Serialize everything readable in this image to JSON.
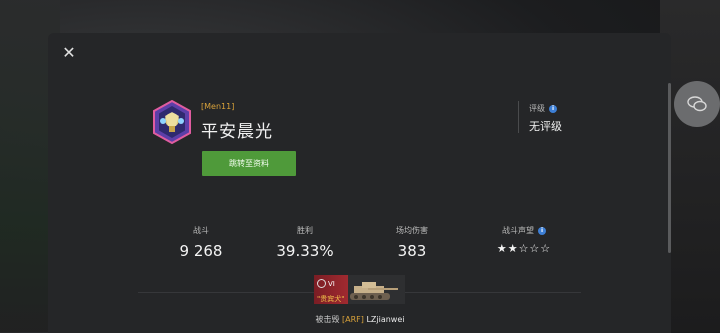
{
  "player": {
    "clan_tag": "[Men11]",
    "name": "平安晨光",
    "goto_profile_label": "跳转至资料"
  },
  "rating": {
    "label": "评级",
    "value": "无评级"
  },
  "stats": [
    {
      "label": "战斗",
      "value": "9 268"
    },
    {
      "label": "胜利",
      "value": "39.33%"
    },
    {
      "label": "场均伤害",
      "value": "383"
    },
    {
      "label": "战斗声望",
      "stars_filled": 2,
      "stars_total": 5,
      "stars_text": "★★☆☆☆"
    }
  ],
  "tank": {
    "tier": "VI",
    "name": "\"贵宾犬\""
  },
  "killed_by": {
    "prefix": "被击毁",
    "clan": "[ARF]",
    "name": "LZjianwei"
  },
  "icons": {
    "close": "close-icon",
    "info": "info-icon",
    "chat": "chat-icon",
    "rank": "rank-badge-icon"
  },
  "colors": {
    "accent_green": "#4f9a3a",
    "clan_gold": "#d9a23a",
    "info_blue": "#3d7fd6"
  }
}
